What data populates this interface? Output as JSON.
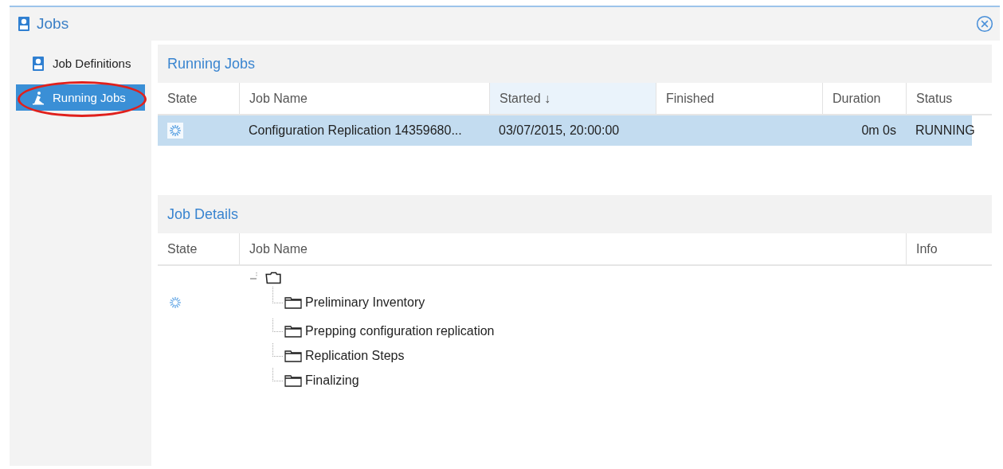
{
  "window": {
    "title": "Jobs"
  },
  "sidebar": {
    "items": [
      {
        "label": "Job Definitions",
        "selected": false
      },
      {
        "label": "Running Jobs",
        "selected": true
      }
    ]
  },
  "highlight": {
    "kind": "ellipse",
    "color": "#e0201c"
  },
  "running_jobs": {
    "title": "Running Jobs",
    "columns": [
      {
        "label": "State",
        "sorted": false
      },
      {
        "label": "Job Name",
        "sorted": false
      },
      {
        "label": "Started ↓",
        "sorted": true
      },
      {
        "label": "Finished",
        "sorted": false
      },
      {
        "label": "Duration",
        "sorted": false
      },
      {
        "label": "Status",
        "sorted": false
      }
    ],
    "rows": [
      {
        "running": true,
        "selected": true,
        "job_name": "Configuration Replication 14359680...",
        "started": "03/07/2015, 20:00:00",
        "duration": "0m 0s",
        "status": "RUNNING"
      }
    ]
  },
  "job_details": {
    "title": "Job Details",
    "columns": [
      "State",
      "Job Name",
      "Info"
    ],
    "tree": {
      "expanded": true,
      "children": [
        {
          "label": "Preliminary Inventory",
          "running": true
        },
        {
          "label": "Prepping configuration replication",
          "running": false
        },
        {
          "label": "Replication Steps",
          "running": false
        },
        {
          "label": "Finalizing",
          "running": false
        }
      ]
    }
  }
}
